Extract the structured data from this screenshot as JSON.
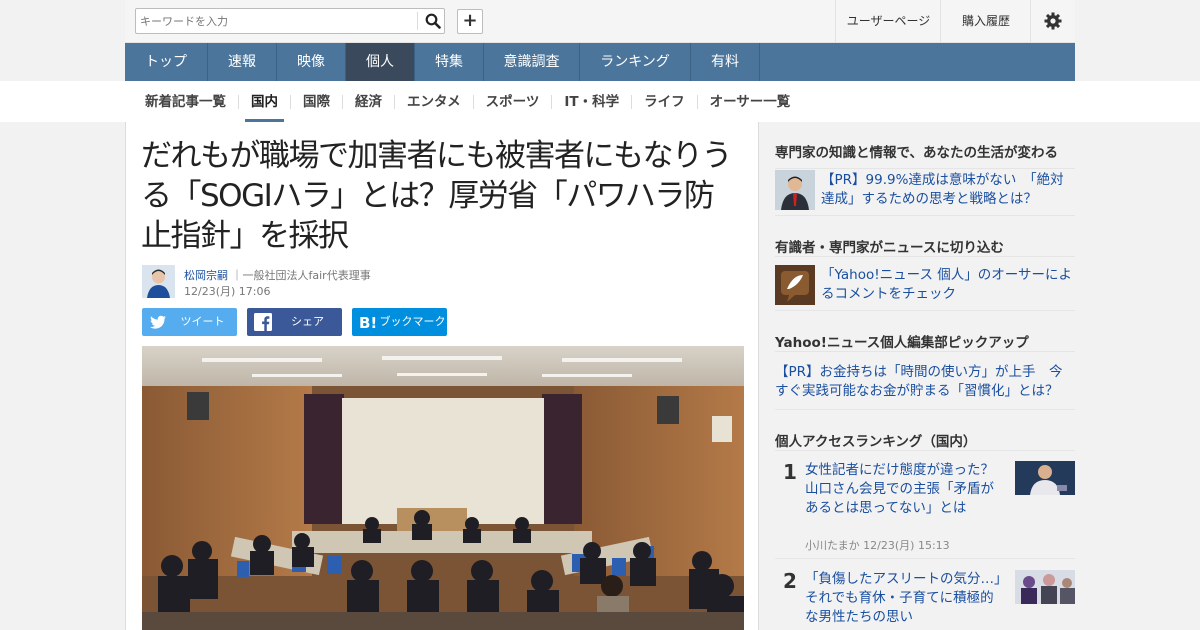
{
  "header": {
    "search_placeholder": "キーワードを入力",
    "plus_label": "+",
    "user_page": "ユーザーページ",
    "purchase_history": "購入履歴"
  },
  "nav": {
    "items": [
      "トップ",
      "速報",
      "映像",
      "個人",
      "特集",
      "意識調査",
      "ランキング",
      "有料"
    ],
    "active": "個人"
  },
  "subnav": {
    "items": [
      "新着記事一覧",
      "国内",
      "国際",
      "経済",
      "エンタメ",
      "スポーツ",
      "IT・科学",
      "ライフ",
      "オーサー一覧"
    ],
    "active": "国内"
  },
  "article": {
    "title": "だれもが職場で加害者にも被害者にもなりうる「SOGIハラ」とは？厚労省「パワハラ防止指針」を採択",
    "author_name": "松岡宗嗣",
    "author_role": "一般社団法人fair代表理事",
    "date": "12/23(月) 17:06",
    "share_twitter": "ツイート",
    "share_facebook": "シェア",
    "share_hatena": "ブックマーク"
  },
  "sidebar": {
    "sec1_title": "専門家の知識と情報で、あなたの生活が変わる",
    "sec1_link": "【PR】99.9%達成は意味がない　「絶対達成」するための思考と戦略とは？",
    "sec2_title": "有識者・専門家がニュースに切り込む",
    "sec2_link": "「Yahoo!ニュース 個人」のオーサーによるコメントをチェック",
    "sec3_title": "Yahoo!ニュース個人編集部ピックアップ",
    "sec3_link": "【PR】お金持ちは「時間の使い方」が上手　今すぐ実践可能なお金が貯まる「習慣化」とは？",
    "ranking_title": "個人アクセスランキング（国内）",
    "ranking": [
      {
        "rank": "1",
        "title": "女性記者にだけ態度が違った？　山口さん会見での主張「矛盾があるとは思ってない」とは",
        "meta": "小川たまか 12/23(月) 15:13"
      },
      {
        "rank": "2",
        "title": "「負傷したアスリートの気分…」それでも育休・子育てに積極的な男性たちの思い",
        "meta": ""
      }
    ]
  }
}
